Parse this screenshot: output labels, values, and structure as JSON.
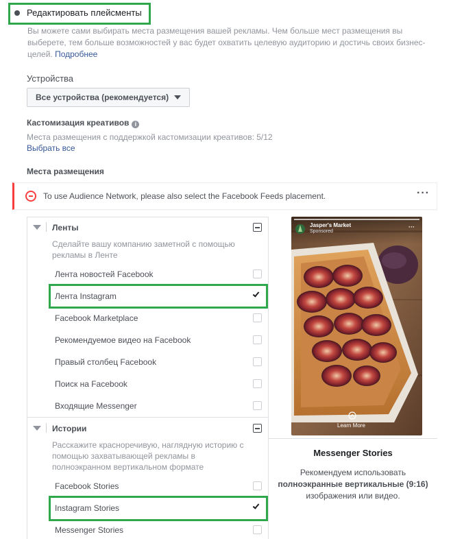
{
  "edit_placements": {
    "label": "Редактировать плейсменты",
    "description": "Вы можете сами выбирать места размещения вашей рекламы. Чем больше мест размещения вы выберете, тем больше возможностей у вас будет охватить целевую аудиторию и достичь своих бизнес-целей.",
    "more_link": "Подробнее"
  },
  "devices": {
    "title": "Устройства",
    "selected": "Все устройства (рекомендуется)"
  },
  "creative_customization": {
    "title": "Кастомизация креативов",
    "info_icon": "info-icon",
    "subtitle": "Места размещения с поддержкой кастомизации креативов: 5/12",
    "select_all": "Выбрать все"
  },
  "placements": {
    "title": "Места размещения",
    "warning": {
      "icon": "error-circle-icon",
      "text": "To use Audience Network, please also select the Facebook Feeds placement.",
      "more": "···"
    },
    "groups": [
      {
        "title": "Ленты",
        "description": "Сделайте вашу компанию заметной с помощью рекламы в Ленте",
        "items": [
          {
            "label": "Лента новостей Facebook",
            "checked": false
          },
          {
            "label": "Лента Instagram",
            "checked": true
          },
          {
            "label": "Facebook Marketplace",
            "checked": false
          },
          {
            "label": "Рекомендуемое видео на Facebook",
            "checked": false
          },
          {
            "label": "Правый столбец Facebook",
            "checked": false
          },
          {
            "label": "Поиск на Facebook",
            "checked": false
          },
          {
            "label": "Входящие Messenger",
            "checked": false
          }
        ]
      },
      {
        "title": "Истории",
        "description": "Расскажите красноречивую, наглядную историю с помощью захватывающей рекламы в полноэкранном вертикальном формате",
        "items": [
          {
            "label": "Facebook Stories",
            "checked": false
          },
          {
            "label": "Instagram Stories",
            "checked": true
          },
          {
            "label": "Messenger Stories",
            "checked": false
          }
        ]
      }
    ]
  },
  "preview": {
    "account_name": "Jasper's Market",
    "sponsored": "Sponsored",
    "learn_more": "Learn More",
    "title": "Messenger Stories",
    "desc_prefix": "Рекомендуем использовать",
    "desc_bold": "полноэкранные вертикальные (9:16)",
    "desc_suffix": "изображения или видео."
  },
  "colors": {
    "highlight": "#2ea84a",
    "error": "#fa3e3e",
    "link": "#365899"
  }
}
